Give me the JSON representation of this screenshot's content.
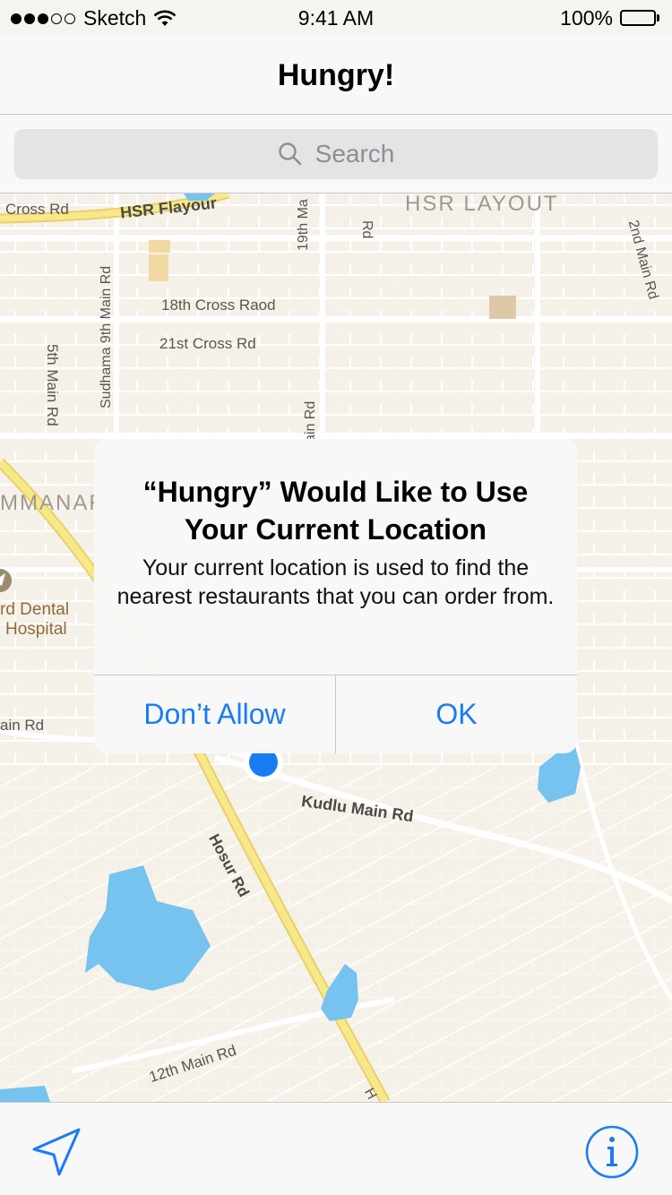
{
  "status_bar": {
    "carrier": "Sketch",
    "time": "9:41 AM",
    "battery": "100%"
  },
  "nav": {
    "title": "Hungry!"
  },
  "search": {
    "placeholder": "Search"
  },
  "map": {
    "labels": {
      "cross_rd": "Cross Rd",
      "hsr_flyover": "HSR Flayour",
      "hsr_layout": "HSR LAYOUT",
      "main_19th": "19th Ma",
      "rd_top": "Rd",
      "main_2nd": "2nd Main Rd",
      "sudhama": "Sudhama 9th Main Rd",
      "cross_18th": "18th Cross Raod",
      "cross_21st": "21st Cross Rd",
      "main_5th": "5th Main Rd",
      "ain_rd": "ain Rd",
      "mmanar": "MMANAR",
      "dental_1": "rd Dental",
      "dental_2": "Hospital",
      "ain_rd_left": "ain Rd",
      "kudlu": "Kudlu Main Rd",
      "hosur": "Hosur Rd",
      "main_12th": "12th Main Rd",
      "h_bottom": "H"
    },
    "colors": {
      "land": "#f5f1e8",
      "road": "#ffffff",
      "highway": "#f7e98a",
      "water": "#75c3ee",
      "block": "#f2d9a4",
      "user_dot": "#1a7cf5"
    }
  },
  "alert": {
    "title": "“Hungry” Would Like to Use Your Current Location",
    "message": "Your current location is used to find the nearest restaurants that you can order from.",
    "deny_label": "Don’t Allow",
    "ok_label": "OK"
  },
  "toolbar": {
    "locate_icon": "location-arrow-icon",
    "info_icon": "info-icon"
  }
}
